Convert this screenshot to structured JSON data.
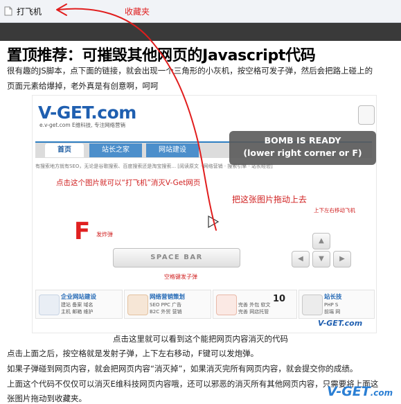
{
  "bookmark_bar": {
    "bookmark_label": "打飞机",
    "annotation": "收藏夹"
  },
  "article": {
    "title": "置顶推荐：可摧毁其他网页的Javascript代码",
    "intro_line1": "很有趣的JS脚本，点下面的链接，就会出现一个三角形的小灰机，按空格可发子弹，然后会把路上碰上的",
    "intro_line2": "页面元素给爆掉，老外真是有创意啊，呵呵",
    "caption": "点击这里就可以看到这个能把网页内容消灭的代码",
    "p1": "点击上面之后，按空格就是发射子弹，上下左右移动，F键可以发炮弹。",
    "p2": "如果子弹碰到网页内容，就会把网页内容“消灭掉”，如果消灭完所有网页内容，就会提交你的成绩。",
    "p3": "上面这个代码不仅仅可以消灭E维科技网页内容哦，还可以邪恶的消灭所有其他网页内容，只需要将上面这",
    "p4": "张图片拖动到收藏夹。"
  },
  "screenshot": {
    "logo": "V-GET.com",
    "logo_sub": "e.v-get.com E维科技, 专注网络营销",
    "nav_tabs": [
      "首页",
      "站长之家",
      "网站建设"
    ],
    "hint": "有搜索地方就有SEO，无论是谷歌搜索、百度搜索还是淘宝搜索... [阅读原文 · 网络营销 · 搜索引擎 · 站长经验]",
    "click_tip": "点击这个图片就可以“打飞机”消灭V-Get网页",
    "bomb_line1": "BOMB IS READY",
    "bomb_line2": "(lower right corner or F)",
    "drag_tip": "把这张图片拖动上去",
    "move_tip": "上下左右移动飞机",
    "f_key": "F",
    "fire_tip": "发炸弹",
    "space_label": "SPACE BAR",
    "space_tip": "空格键发子弹",
    "counter": "10",
    "services": [
      {
        "title": "企业网站建设",
        "line1": "建站 备案 域名",
        "line2": "主机 邮箱 维护"
      },
      {
        "title": "网络营销策划",
        "line1": "SEO PPC 广告",
        "line2": "B2C 外贸 营销"
      },
      {
        "title": "",
        "line1": "完善 外包 软文",
        "line2": "完善 网店托管"
      },
      {
        "title": "站长技",
        "line1": "PHP S",
        "line2": "前端 网"
      }
    ],
    "footer_logo": "V-GET.com"
  },
  "watermark": {
    "main": "V-GET",
    "suffix": ".com"
  },
  "colors": {
    "annotation_red": "#e02020",
    "brand_blue": "#1f5fb0"
  }
}
